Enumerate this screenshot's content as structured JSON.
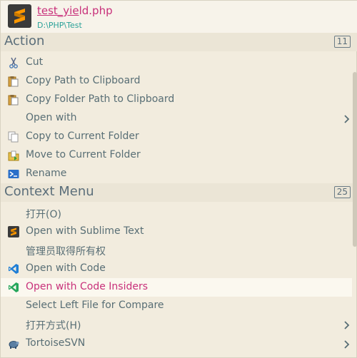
{
  "header": {
    "file_name_match": "test_yie",
    "file_name_rest": "ld.php",
    "file_path": "D:\\PHP\\Test"
  },
  "sections": {
    "action": {
      "title": "Action",
      "count": "11"
    },
    "context": {
      "title": "Context Menu",
      "count": "25"
    }
  },
  "action_items": [
    {
      "label": "Cut",
      "icon": "scissors-icon"
    },
    {
      "label": "Copy Path to Clipboard",
      "icon": "clipboard-icon"
    },
    {
      "label": "Copy Folder Path to Clipboard",
      "icon": "clipboard-icon"
    },
    {
      "label": "Open with",
      "icon": "",
      "submenu": true
    },
    {
      "label": "Copy to Current Folder",
      "icon": "copy-document-icon"
    },
    {
      "label": "Move to Current Folder",
      "icon": "move-folder-icon"
    },
    {
      "label": "Rename",
      "icon": "rename-icon"
    }
  ],
  "context_items": [
    {
      "label": "打开(O)",
      "icon": ""
    },
    {
      "label": "Open with Sublime Text",
      "icon": "sublime-text-icon"
    },
    {
      "label": "管理员取得所有权",
      "icon": ""
    },
    {
      "label": "Open with Code",
      "icon": "vscode-icon"
    },
    {
      "label": "Open with Code Insiders",
      "icon": "vscode-insiders-icon",
      "highlighted": true
    },
    {
      "label": "Select Left File for Compare",
      "icon": ""
    },
    {
      "label": "打开方式(H)",
      "icon": "",
      "submenu": true
    },
    {
      "label": "TortoiseSVN",
      "icon": "tortoisesvn-icon",
      "submenu": true
    }
  ],
  "colors": {
    "background": "#f2ecde",
    "highlight_text": "#c8307a",
    "item_text": "#586e75",
    "section_text": "#5b6e7a",
    "path_text": "#2aa198"
  }
}
